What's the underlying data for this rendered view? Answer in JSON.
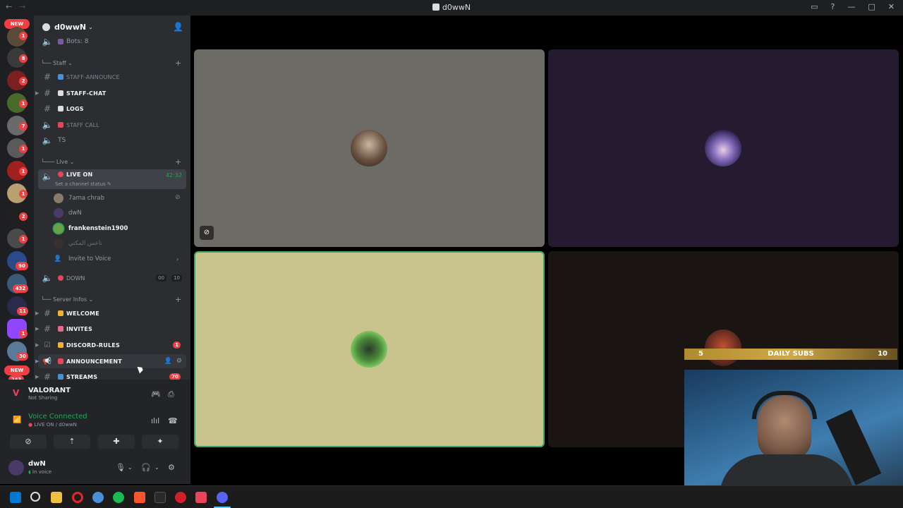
{
  "window": {
    "title": "d0wwN"
  },
  "guild_rail": {
    "new_label": "NEW",
    "badges": [
      "1",
      "8",
      "2",
      "1",
      "7",
      "1",
      "1",
      "1",
      "2",
      "1",
      "90",
      "432",
      "11",
      "1",
      "30"
    ],
    "bottom_new_label": "NEW",
    "bottom_count": "243"
  },
  "server": {
    "name": "d0wwN"
  },
  "channels": {
    "bots": "Bots: 8",
    "staff_category": "Staff",
    "staff_announce": "STAFF-ANNOUNCE",
    "staff_chat": "STAFF-CHAT",
    "logs": "LOGS",
    "staff_call": "STAFF CALL",
    "ts": "TS",
    "live_category": "Llve",
    "live_on": "LIVE ON",
    "live_timer": "42:32",
    "channel_status": "Set a channel status",
    "members": [
      "7ama chrab",
      "dwN",
      "frankenstein1900",
      "ناعس المكتي"
    ],
    "invite_to_voice": "Invite to Voice",
    "down": "DOWN",
    "down_count_a": "00",
    "down_count_b": "10",
    "server_infos_category": "Server Infos",
    "welcome": "WELCOME",
    "invites": "INVITES",
    "discord_rules": "DISCORD-RULES",
    "discord_rules_badge": "1",
    "announcement": "ANNOUNCEMENT",
    "streams": "STREAMS",
    "streams_badge": "70"
  },
  "activity": {
    "game": "VALORANT",
    "status": "Not Sharing"
  },
  "voice": {
    "status": "Voice Connected",
    "location": "LIVE ON / d0wwN"
  },
  "user": {
    "name": "dwN",
    "status": "In voice"
  },
  "overlay": {
    "subs_current": "5",
    "subs_label": "DAILY SUBS",
    "subs_goal": "10"
  },
  "colors": {
    "accent_green": "#23a55a",
    "danger": "#f23f43",
    "speaking_border": "#3ba55c",
    "tile_gray": "#6d6b66",
    "tile_purple": "#241b30",
    "tile_khaki": "#c9c38e",
    "tile_dark": "#1a1512"
  }
}
